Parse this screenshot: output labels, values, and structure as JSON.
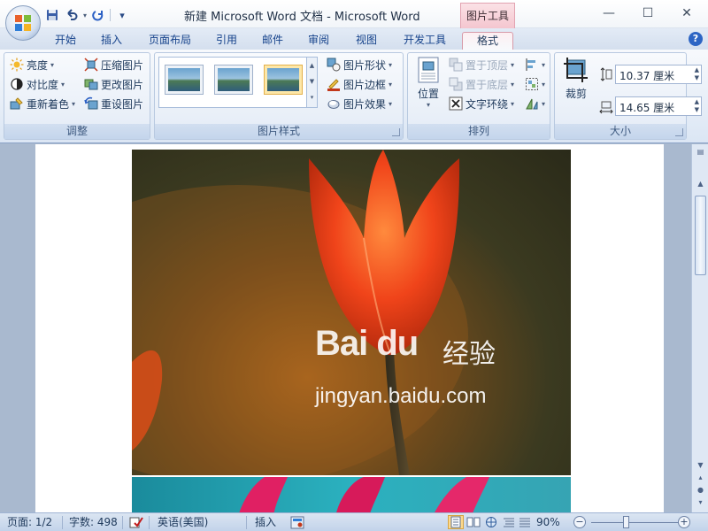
{
  "window": {
    "title": "新建 Microsoft Word 文档 - Microsoft Word",
    "context_tab_header": "图片工具"
  },
  "tabs": [
    "开始",
    "插入",
    "页面布局",
    "引用",
    "邮件",
    "审阅",
    "视图",
    "开发工具",
    "格式"
  ],
  "ribbon": {
    "adjust": {
      "brightness": "亮度",
      "contrast": "对比度",
      "recolor": "重新着色",
      "compress": "压缩图片",
      "change": "更改图片",
      "reset": "重设图片",
      "label": "调整"
    },
    "styles": {
      "shape": "图片形状",
      "border": "图片边框",
      "effects": "图片效果",
      "label": "图片样式"
    },
    "arrange": {
      "position": "位置",
      "bring_front": "置于顶层",
      "send_back": "置于底层",
      "text_wrap": "文字环绕",
      "label": "排列"
    },
    "size": {
      "crop": "裁剪",
      "height": "10.37 厘米",
      "width": "14.65 厘米",
      "label": "大小"
    }
  },
  "document": {
    "watermark_logo": "Bai du",
    "watermark_cn": "经验",
    "watermark_url": "jingyan.baidu.com"
  },
  "statusbar": {
    "page": "页面: 1/2",
    "words": "字数: 498",
    "language": "英语(美国)",
    "mode": "插入",
    "zoom": "90%"
  },
  "colors": {
    "accent_blue": "#15428b",
    "context_pink": "#f4c6cf",
    "ribbon_bg": "#dbe6f4"
  }
}
